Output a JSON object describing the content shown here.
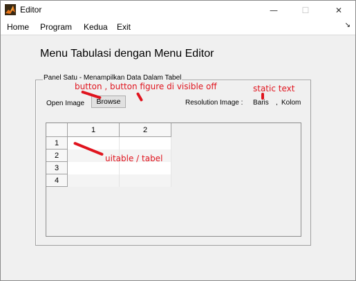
{
  "window": {
    "title": "Editor",
    "minimize_glyph": "—",
    "maximize_glyph": "☐",
    "close_glyph": "✕"
  },
  "menu": {
    "items": [
      "Home",
      "Program",
      "Kedua",
      "Exit"
    ],
    "overflow_glyph": "↘"
  },
  "main": {
    "title": "Menu Tabulasi dengan Menu Editor"
  },
  "panel": {
    "title": "Panel Satu - Menampilkan Data Dalam Tabel",
    "open_image_label": "Open Image",
    "browse_label": "Browse",
    "resolution_label": "Resolution Image :",
    "baris_text": "Baris",
    "comma": ",",
    "kolom_text": "Kolom"
  },
  "table": {
    "columns": [
      "1",
      "2"
    ],
    "rows": [
      "1",
      "2",
      "3",
      "4"
    ]
  },
  "annotations": {
    "button_note": "button , button figure di visible off",
    "static_note": "static text",
    "table_note": "uitable / tabel"
  },
  "colors": {
    "annotation": "#e0141e",
    "icon_orange": "#e8751a",
    "icon_dark": "#3a2a14"
  },
  "icons": {
    "app": "matlab-icon"
  }
}
